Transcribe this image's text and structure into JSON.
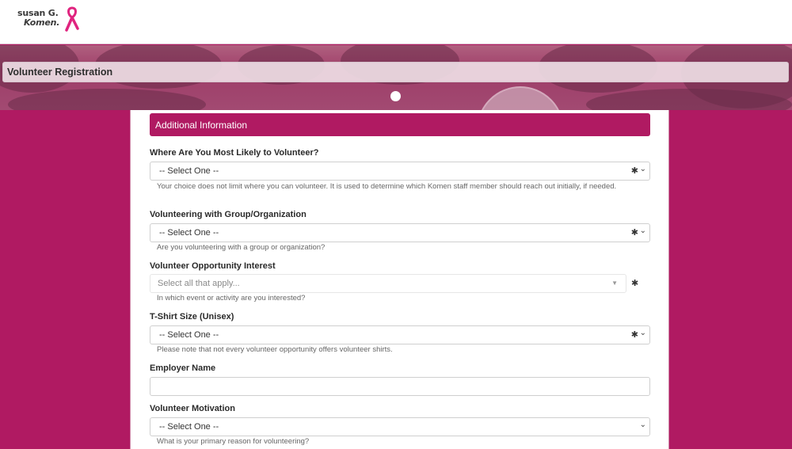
{
  "header": {
    "logo_line1": "susan G.",
    "logo_line2": "Komen."
  },
  "banner": {
    "title": "Volunteer Registration"
  },
  "section": {
    "title": "Additional Information"
  },
  "fields": {
    "volunteer_location": {
      "label": "Where Are You Most Likely to Volunteer?",
      "value": "-- Select One --",
      "required_mark": "✱",
      "help": "Your choice does not limit where you can volunteer. It is used to determine which Komen staff member should reach out initially, if needed."
    },
    "group": {
      "label": "Volunteering with Group/Organization",
      "value": "-- Select One --",
      "required_mark": "✱",
      "help": "Are you volunteering with a group or organization?"
    },
    "opportunity": {
      "label": "Volunteer Opportunity Interest",
      "placeholder": "Select all that apply...",
      "required_mark": "✱",
      "help": "In which event or activity are you interested?"
    },
    "tshirt": {
      "label": "T-Shirt Size (Unisex)",
      "value": "-- Select One --",
      "required_mark": "✱",
      "help": "Please note that not every volunteer opportunity offers volunteer shirts."
    },
    "employer": {
      "label": "Employer Name",
      "value": ""
    },
    "motivation": {
      "label": "Volunteer Motivation",
      "value": "-- Select One --",
      "help": "What is your primary reason for volunteering?"
    }
  },
  "icons": {
    "chevron": "chevron-down-icon",
    "caret": "caret-down-icon",
    "required": "asterisk-icon",
    "logo": "pink-ribbon-icon"
  },
  "colors": {
    "brand": "#b01a62",
    "banner_overlay": "#9e3d68"
  }
}
